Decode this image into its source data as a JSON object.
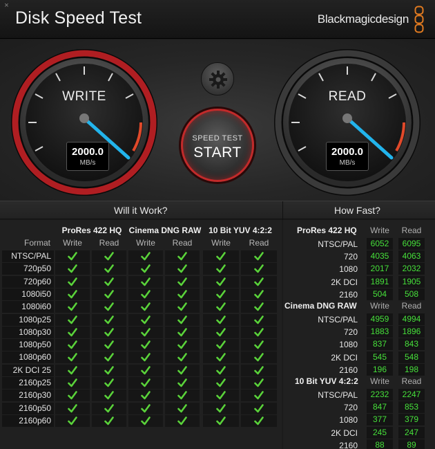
{
  "window": {
    "close_glyph": "×"
  },
  "header": {
    "title": "Disk Speed Test",
    "brand": "Blackmagicdesign",
    "brand_color": "#e07a20"
  },
  "write_gauge": {
    "label": "WRITE",
    "value": "2000.0",
    "unit": "MB/s",
    "ring_color": "#b01e22",
    "needle_color": "#22b4ec"
  },
  "read_gauge": {
    "label": "READ",
    "value": "2000.0",
    "unit": "MB/s",
    "ring_color": "#3a3a3a",
    "needle_color": "#22b4ec"
  },
  "controls": {
    "settings_icon": "gear-icon",
    "start_small": "SPEED TEST",
    "start_big": "START"
  },
  "will_it_work": {
    "title": "Will it Work?",
    "format_label": "Format",
    "codecs": [
      "ProRes 422 HQ",
      "Cinema DNG RAW",
      "10 Bit YUV 4:2:2"
    ],
    "sub_labels": [
      "Write",
      "Read",
      "Write",
      "Read",
      "Write",
      "Read"
    ],
    "formats": [
      "NTSC/PAL",
      "720p50",
      "720p60",
      "1080i50",
      "1080i60",
      "1080p25",
      "1080p30",
      "1080p50",
      "1080p60",
      "2K DCI 25",
      "2160p25",
      "2160p30",
      "2160p50",
      "2160p60"
    ],
    "check_color": "#5ad33a"
  },
  "how_fast": {
    "title": "How Fast?",
    "groups": [
      {
        "name": "ProRes 422 HQ",
        "col_write": "Write",
        "col_read": "Read",
        "rows": [
          {
            "res": "NTSC/PAL",
            "write": "6052",
            "read": "6095"
          },
          {
            "res": "720",
            "write": "4035",
            "read": "4063"
          },
          {
            "res": "1080",
            "write": "2017",
            "read": "2032"
          },
          {
            "res": "2K DCI",
            "write": "1891",
            "read": "1905"
          },
          {
            "res": "2160",
            "write": "504",
            "read": "508"
          }
        ]
      },
      {
        "name": "Cinema DNG RAW",
        "col_write": "Write",
        "col_read": "Read",
        "rows": [
          {
            "res": "NTSC/PAL",
            "write": "4959",
            "read": "4994"
          },
          {
            "res": "720",
            "write": "1883",
            "read": "1896"
          },
          {
            "res": "1080",
            "write": "837",
            "read": "843"
          },
          {
            "res": "2K DCI",
            "write": "545",
            "read": "548"
          },
          {
            "res": "2160",
            "write": "196",
            "read": "198"
          }
        ]
      },
      {
        "name": "10 Bit YUV 4:2:2",
        "col_write": "Write",
        "col_read": "Read",
        "rows": [
          {
            "res": "NTSC/PAL",
            "write": "2232",
            "read": "2247"
          },
          {
            "res": "720",
            "write": "847",
            "read": "853"
          },
          {
            "res": "1080",
            "write": "377",
            "read": "379"
          },
          {
            "res": "2K DCI",
            "write": "245",
            "read": "247"
          },
          {
            "res": "2160",
            "write": "88",
            "read": "89"
          }
        ]
      }
    ]
  }
}
